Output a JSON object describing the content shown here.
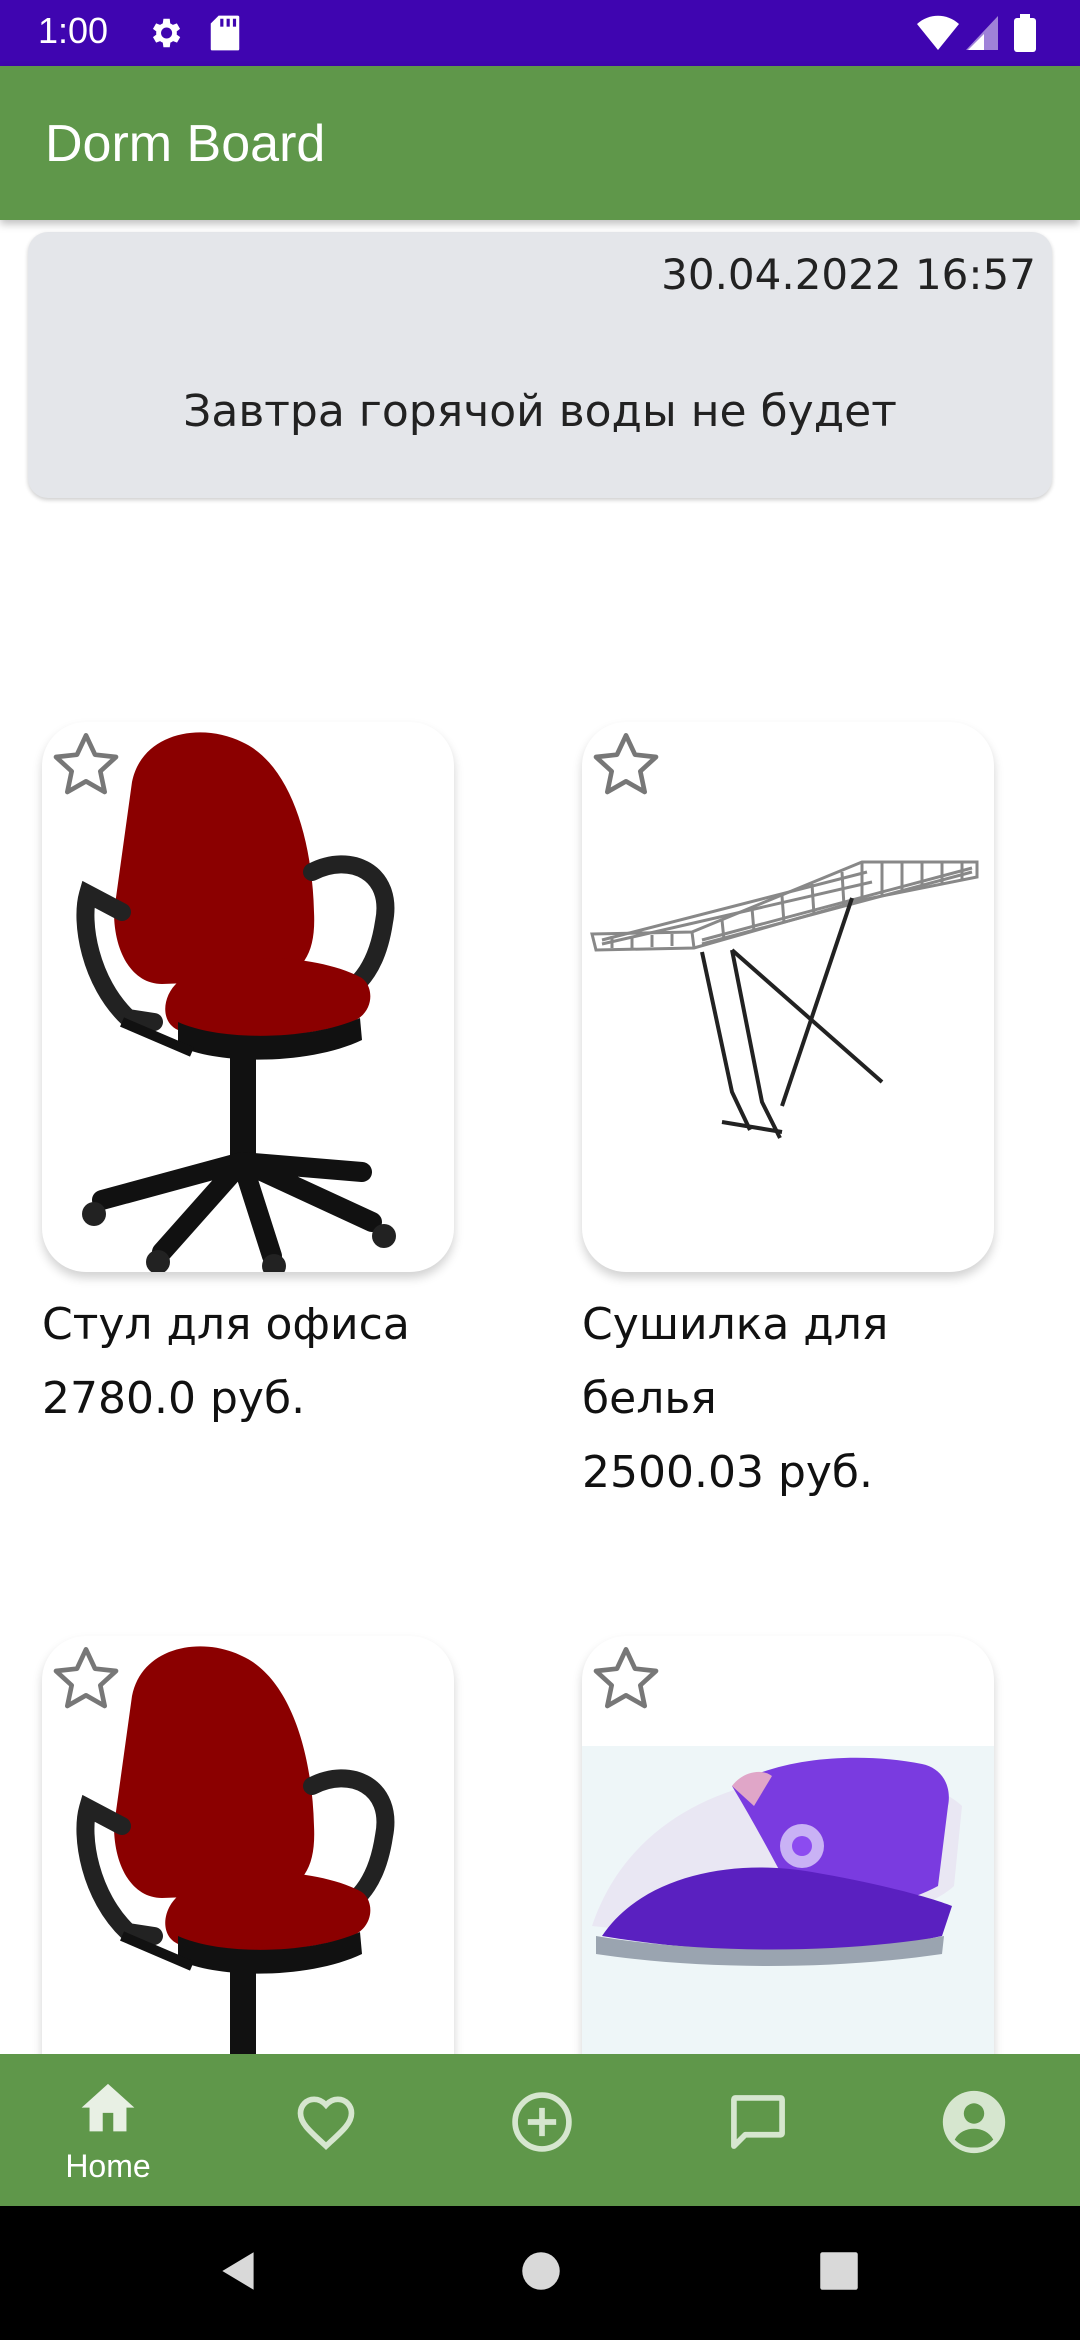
{
  "status_bar": {
    "time": "1:00"
  },
  "app_bar": {
    "title": "Dorm Board"
  },
  "notice": {
    "date": "30.04.2022 16:57",
    "text": "Завтра горячой воды не будет"
  },
  "products": [
    {
      "name": "Стул для офиса",
      "price": "2780.0",
      "currency": "руб.",
      "image": "office-chair"
    },
    {
      "name": "Сушилка для белья",
      "price": "2500.03",
      "currency": "руб.",
      "image": "clothes-dryer-rack"
    },
    {
      "name": "",
      "price": "",
      "currency": "",
      "image": "office-chair"
    },
    {
      "name": "",
      "price": "",
      "currency": "",
      "image": "steam-iron"
    }
  ],
  "bottom_nav": {
    "items": [
      {
        "label": "Home",
        "icon": "home-icon",
        "active": true
      },
      {
        "label": "",
        "icon": "heart-icon"
      },
      {
        "label": "",
        "icon": "add-circle-icon"
      },
      {
        "label": "",
        "icon": "chat-icon"
      },
      {
        "label": "",
        "icon": "account-icon"
      }
    ]
  },
  "colors": {
    "status_bar": "#3f05b0",
    "app_bar": "#5f974a",
    "notice_bg": "#e4e6ea",
    "chair_red": "#8b0000",
    "iron_purple": "#7a3be0"
  }
}
